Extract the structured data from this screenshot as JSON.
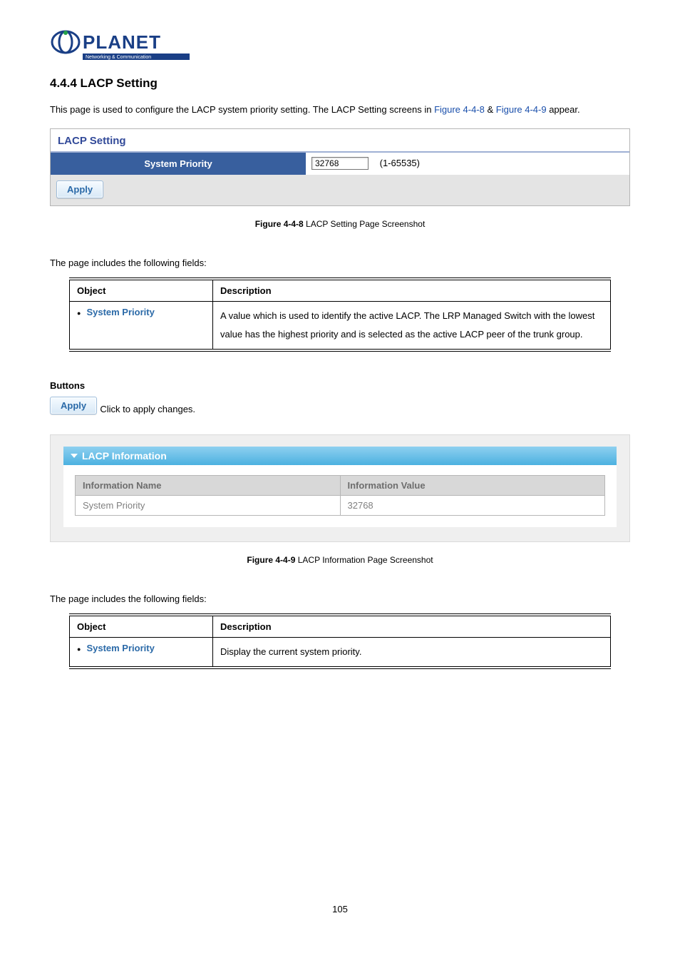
{
  "brand": {
    "name": "PLANET",
    "tagline": "Networking & Communication"
  },
  "section": {
    "number": "4.4.4",
    "title": "LACP Setting"
  },
  "intro": {
    "before_link1": "This page is used to configure the LACP system priority setting. The LACP Setting screens in ",
    "link1": "Figure 4-4-8",
    "between": " & ",
    "link2": "Figure 4-4-9",
    "after": " appear."
  },
  "ui1": {
    "title": "LACP Setting",
    "row_label": "System Priority",
    "input_value": "32768",
    "range": "(1-65535)",
    "apply": "Apply"
  },
  "caption1": {
    "bold": "Figure 4-4-8",
    "rest": " LACP Setting Page Screenshot"
  },
  "fields_intro": "The page includes the following fields:",
  "table1": {
    "headers": {
      "object": "Object",
      "description": "Description"
    },
    "row": {
      "object": "System Priority",
      "description": "A value which is used to identify the active LACP. The LRP Managed Switch with the lowest value has the highest priority and is selected as the active LACP peer of the trunk group."
    }
  },
  "buttons": {
    "heading": "Buttons",
    "apply": "Apply",
    "desc": ": Click to apply changes."
  },
  "ui2": {
    "title": "LACP Information",
    "headers": {
      "name": "Information Name",
      "value": "Information Value"
    },
    "row": {
      "name": "System Priority",
      "value": "32768"
    }
  },
  "caption2": {
    "bold": "Figure 4-4-9",
    "rest": " LACP Information Page Screenshot"
  },
  "table2": {
    "headers": {
      "object": "Object",
      "description": "Description"
    },
    "row": {
      "object": "System Priority",
      "description": "Display the current system priority."
    }
  },
  "page_number": "105"
}
